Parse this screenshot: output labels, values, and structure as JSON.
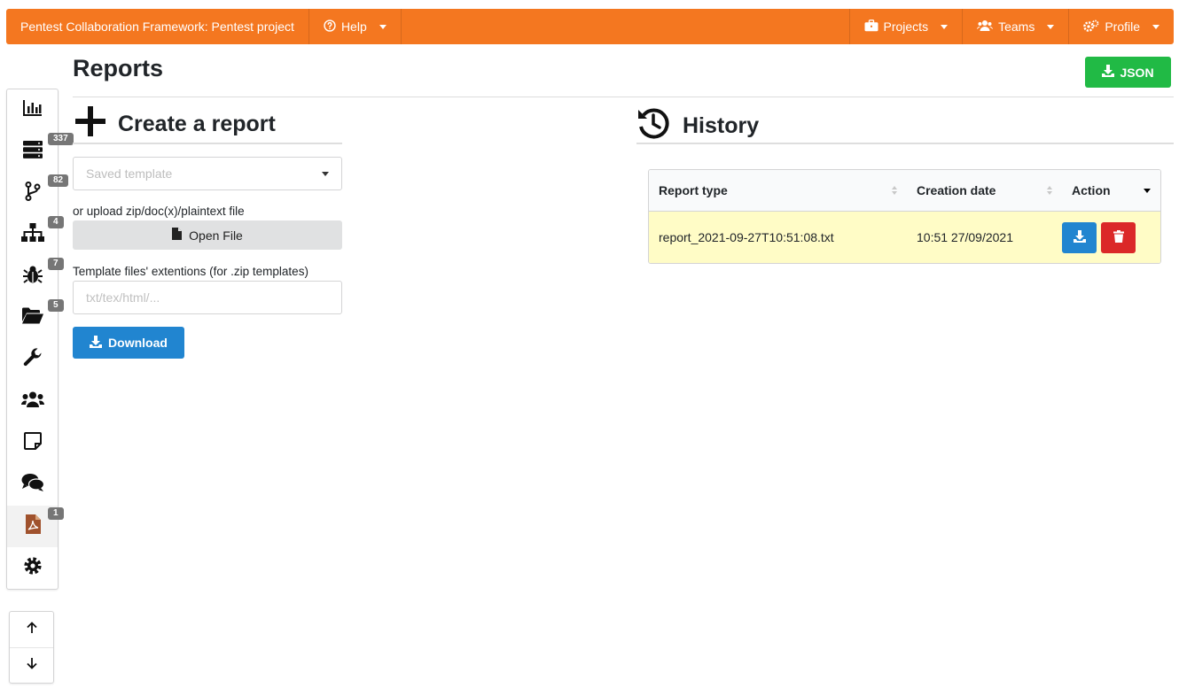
{
  "topbar": {
    "brand": "Pentest Collaboration Framework: Pentest project",
    "help": "Help",
    "projects": "Projects",
    "teams": "Teams",
    "profile": "Profile",
    "color": "#f47720"
  },
  "sidebar": {
    "badges": {
      "hosts": "337",
      "network": "82",
      "tree": "4",
      "issues": "7",
      "files": "5",
      "reports": "1"
    }
  },
  "page": {
    "title": "Reports",
    "json_button": "JSON"
  },
  "create": {
    "heading": "Create a report",
    "template_placeholder": "Saved template",
    "upload_label": "or upload zip/doc(x)/plaintext file",
    "open_file": "Open File",
    "ext_label": "Template files' extentions (for .zip templates)",
    "ext_placeholder": "txt/tex/html/...",
    "download": "Download"
  },
  "history": {
    "heading": "History",
    "columns": [
      "Report type",
      "Creation date",
      "Action"
    ],
    "rows": [
      {
        "report_type": "report_2021-09-27T10:51:08.txt",
        "creation_date": "10:51 27/09/2021"
      }
    ]
  }
}
